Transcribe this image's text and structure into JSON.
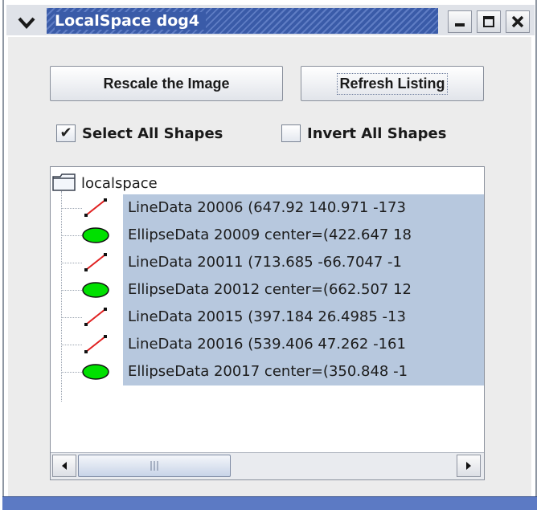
{
  "window": {
    "title": "LocalSpace dog4",
    "controls": [
      "minimize-icon",
      "maximize-icon",
      "close-icon"
    ]
  },
  "buttons": {
    "rescale": "Rescale the Image",
    "refresh": "Refresh Listing"
  },
  "checkboxes": {
    "select_all": {
      "label": "Select All Shapes",
      "checked": true
    },
    "invert_all": {
      "label": "Invert All Shapes",
      "checked": false
    }
  },
  "tree": {
    "root": "localspace",
    "items": [
      {
        "label": "LineData 20006 (647.92 140.971 -173",
        "icon": "line-icon",
        "selected": true
      },
      {
        "label": "EllipseData 20009 center=(422.647 18",
        "icon": "ellipse-icon",
        "selected": true
      },
      {
        "label": "LineData 20011 (713.685 -66.7047 -1",
        "icon": "line-icon",
        "selected": true
      },
      {
        "label": "EllipseData 20012 center=(662.507 12",
        "icon": "ellipse-icon",
        "selected": true
      },
      {
        "label": "LineData 20015 (397.184 26.4985 -13",
        "icon": "line-icon",
        "selected": true
      },
      {
        "label": "LineData 20016 (539.406 47.262 -161",
        "icon": "line-icon",
        "selected": true
      },
      {
        "label": "EllipseData 20017 center=(350.848 -1",
        "icon": "ellipse-icon",
        "selected": true
      }
    ]
  },
  "colors": {
    "title_active": "#3a5ba8",
    "selection": "#b7c8de",
    "ellipse_fill": "#00e000",
    "line_color": "#e02020"
  }
}
